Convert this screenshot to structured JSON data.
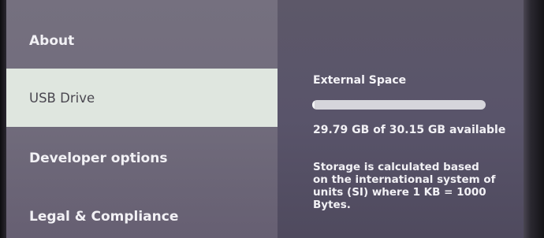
{
  "menu": {
    "items": [
      {
        "label": "About"
      },
      {
        "label": "USB Drive",
        "selected": true
      },
      {
        "label": "Developer options"
      },
      {
        "label": "Legal & Compliance"
      }
    ]
  },
  "detail": {
    "title": "External Space",
    "storage": {
      "used_fraction": 0.012,
      "available_text": "29.79 GB of 30.15 GB available"
    },
    "info": "Storage is calculated based\non the international system of\nunits (SI) where 1 KB = 1000\nBytes."
  },
  "colors": {
    "selected_bg": "#dfe6df",
    "menu_bg": "#716c7c",
    "detail_bg": "#59546a",
    "text": "#f2f1f5"
  }
}
